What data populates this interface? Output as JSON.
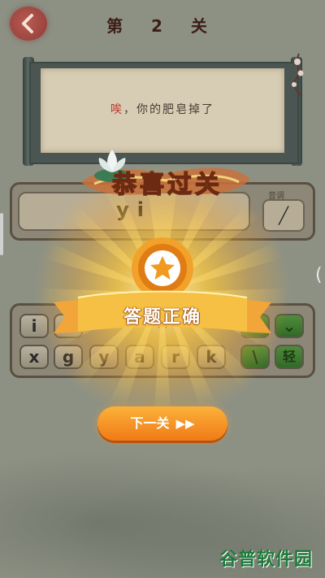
{
  "header": {
    "level_title": "第 2 关"
  },
  "question": {
    "hint_prefix": "唉",
    "hint_rest": "，你的肥皂掉了"
  },
  "answer": {
    "current": "yi",
    "audio_label": "音调"
  },
  "keyboard": {
    "row1": [
      "i",
      "",
      "",
      "",
      "",
      ""
    ],
    "row2": [
      "x",
      "g",
      "y",
      "a",
      "r",
      "k"
    ],
    "special_keys": {
      "falling_tone": "\\",
      "light_tone": "轻"
    }
  },
  "success": {
    "banner_title": "恭喜过关",
    "ribbon_text": "答题正确"
  },
  "next_button": {
    "label": "下一关",
    "icon": "fast-forward-icon"
  },
  "watermark": {
    "text": "谷普软件园"
  },
  "colors": {
    "accent_orange": "#f59a2a",
    "key_green": "#3f7c32",
    "scroll_paper": "#d7ccb4"
  }
}
